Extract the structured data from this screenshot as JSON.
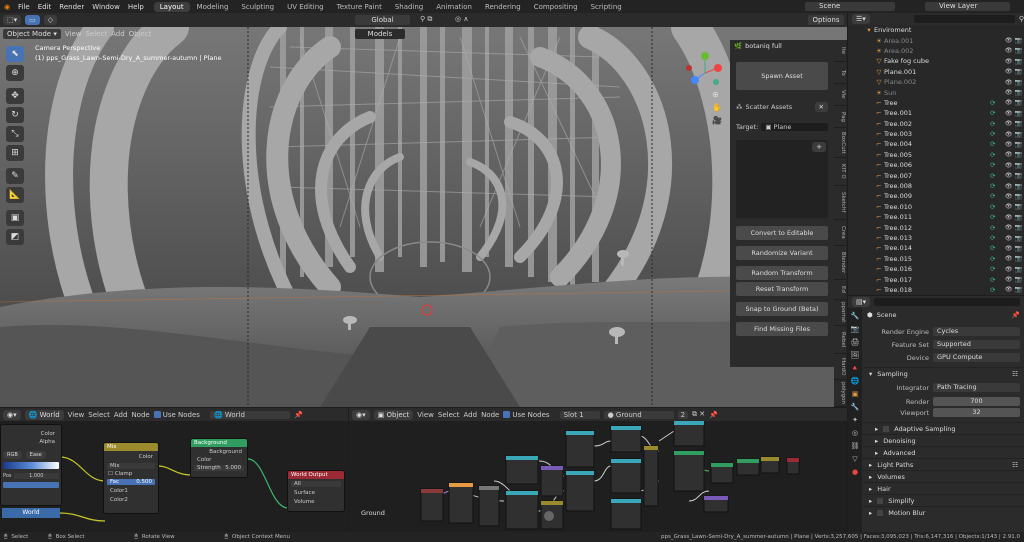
{
  "menu": [
    "File",
    "Edit",
    "Render",
    "Window",
    "Help"
  ],
  "workspaces": [
    "Layout",
    "Modeling",
    "Sculpting",
    "UV Editing",
    "Texture Paint",
    "Shading",
    "Animation",
    "Rendering",
    "Compositing",
    "Scripting"
  ],
  "active_workspace": 0,
  "scene_name": "Scene",
  "view_layer": "View Layer",
  "viewport": {
    "mode": "Object Mode",
    "menus": [
      "View",
      "Select",
      "Add",
      "Object"
    ],
    "orientation": "Global",
    "options": "Options",
    "camera_label": "Camera Perspective",
    "object_label": "(1) pps_Grass_Lawn-Semi-Dry_A_summer-autumn | Plane",
    "collection_dropdown": "Models"
  },
  "botaniq": {
    "title": "botaniq full",
    "spawn": "Spawn Asset",
    "scatter": "Scatter Assets",
    "target_label": "Target:",
    "target_value": "Plane",
    "buttons": [
      "Convert to Editable",
      "Randomize Variant",
      "Random Transform",
      "Reset Transform",
      "Snap to Ground (Beta)",
      "Find Missing Files"
    ]
  },
  "sidebar_tabs": [
    "Ite",
    "To",
    "Vie",
    "Pag",
    "BoxCutt",
    "KIT O",
    "Sketchf",
    "Crea",
    "Blender",
    "Ed",
    "pparrat",
    "Rebel",
    "HardO",
    "polygon"
  ],
  "outliner": {
    "root": "Enviroment",
    "items": [
      {
        "name": "Area.001",
        "dim": true
      },
      {
        "name": "Area.002",
        "dim": true
      },
      {
        "name": "Fake fog cube",
        "dim": false
      },
      {
        "name": "Plane.001",
        "dim": false
      },
      {
        "name": "Plane.002",
        "dim": true
      },
      {
        "name": "Sun",
        "dim": true
      },
      {
        "name": "Tree",
        "dim": false
      },
      {
        "name": "Tree.001",
        "dim": false
      },
      {
        "name": "Tree.002",
        "dim": false
      },
      {
        "name": "Tree.003",
        "dim": false
      },
      {
        "name": "Tree.004",
        "dim": false
      },
      {
        "name": "Tree.005",
        "dim": false
      },
      {
        "name": "Tree.006",
        "dim": false
      },
      {
        "name": "Tree.007",
        "dim": false
      },
      {
        "name": "Tree.008",
        "dim": false
      },
      {
        "name": "Tree.009",
        "dim": false
      },
      {
        "name": "Tree.010",
        "dim": false
      },
      {
        "name": "Tree.011",
        "dim": false
      },
      {
        "name": "Tree.012",
        "dim": false
      },
      {
        "name": "Tree.013",
        "dim": false
      },
      {
        "name": "Tree.014",
        "dim": false
      },
      {
        "name": "Tree.015",
        "dim": false
      },
      {
        "name": "Tree.016",
        "dim": false
      },
      {
        "name": "Tree.017",
        "dim": false
      },
      {
        "name": "Tree.018",
        "dim": false
      }
    ]
  },
  "properties": {
    "scene": "Scene",
    "render_engine_label": "Render Engine",
    "render_engine": "Cycles",
    "feature_set_label": "Feature Set",
    "feature_set": "Supported",
    "device_label": "Device",
    "device": "GPU Compute",
    "sampling": "Sampling",
    "integrator_label": "Integrator",
    "integrator": "Path Tracing",
    "render_label": "Render",
    "render_samples": "700",
    "viewport_label": "Viewport",
    "viewport_samples": "32",
    "sections": [
      "Adaptive Sampling",
      "Denoising",
      "Advanced"
    ],
    "top_sections": [
      "Light Paths",
      "Volumes",
      "Hair",
      "Simplify",
      "Motion Blur"
    ]
  },
  "world_editor": {
    "type": "World",
    "menus": [
      "View",
      "Select",
      "Add",
      "Node"
    ],
    "use_nodes": "Use Nodes",
    "world": "World",
    "bottom_label": "World",
    "nodes": {
      "left_color": "Color",
      "left_alpha": "Alpha",
      "rgb": "RGB",
      "ease": "Ease",
      "pos": "Pos",
      "pos_val": "1.000",
      "mix": "Mix",
      "mix_mode": "Mix",
      "clamp": "Clamp",
      "fac": "Fac",
      "fac_val": "0.500",
      "color1": "Color1",
      "color2": "Color2",
      "mix_out": "Color",
      "background": "Background",
      "bg_out": "Background",
      "bg_color": "Color",
      "strength": "Strength",
      "strength_val": "5.000",
      "world_output": "World Output",
      "all": "All",
      "surface": "Surface",
      "volume": "Volume"
    }
  },
  "shader_editor": {
    "type": "Object",
    "menus": [
      "View",
      "Select",
      "Add",
      "Node"
    ],
    "use_nodes": "Use Nodes",
    "slot": "Slot 1",
    "material": "Ground",
    "users": "2",
    "bottom_label": "Ground"
  },
  "status": {
    "select": "Select",
    "box": "Box Select",
    "rotate": "Rotate View",
    "context": "Object Context Menu",
    "stats": "pps_Grass_Lawn-Semi-Dry_A_summer-autumn | Plane | Verts:3,257,605 | Faces:3,095,023 | Tris:6,147,316 | Objects:1/143 | 2.91.0"
  },
  "colors": {
    "accent": "#4772b3",
    "mix_header": "#9a8c2d",
    "bg_header": "#2f9e60",
    "wo_header": "#9b2a34",
    "tree_glyph": "#3fb58a",
    "obj_orange": "#e69a42"
  }
}
